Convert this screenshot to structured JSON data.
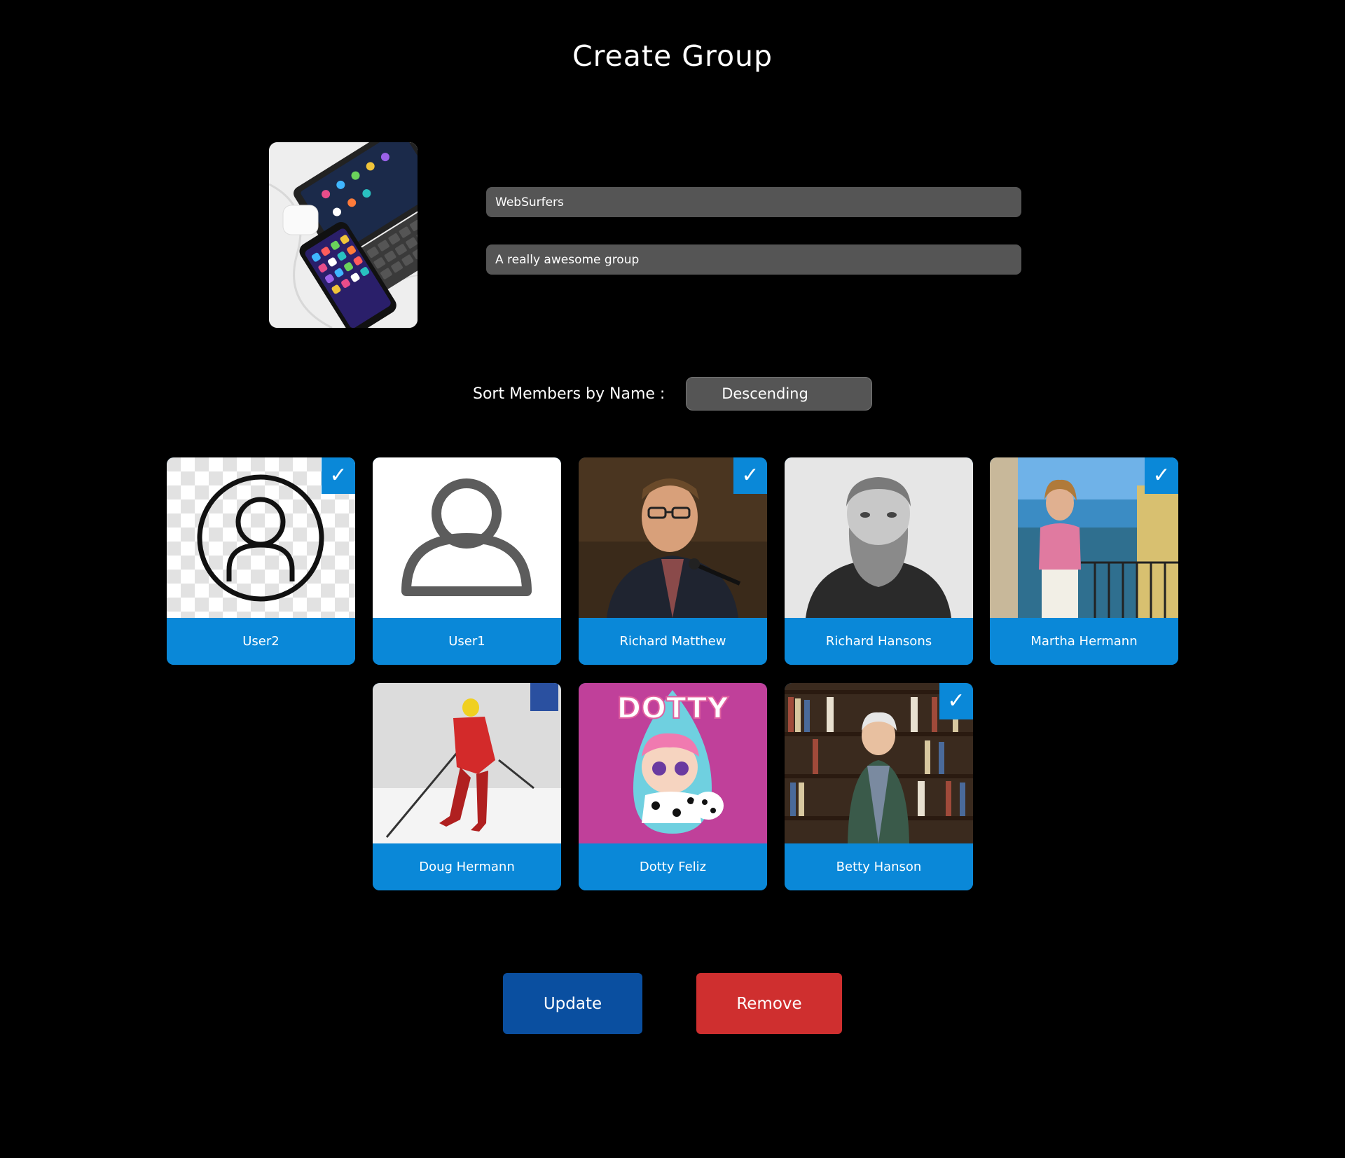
{
  "page": {
    "title": "Create Group"
  },
  "group": {
    "image_icon": "group-photo-devices",
    "name_value": "WebSurfers",
    "description_value": "A really awesome group"
  },
  "sort": {
    "label": "Sort Members by Name :",
    "selected": "Descending"
  },
  "members": [
    {
      "name": "User2",
      "selected": true,
      "photo": "default-avatar-outline-icon"
    },
    {
      "name": "User1",
      "selected": false,
      "photo": "default-avatar-gray-icon"
    },
    {
      "name": "Richard Matthew",
      "selected": true,
      "photo": "man-with-glasses-portrait"
    },
    {
      "name": "Richard Hansons",
      "selected": false,
      "photo": "bearded-man-vintage-portrait"
    },
    {
      "name": "Martha Hermann",
      "selected": true,
      "photo": "woman-on-balcony-portrait"
    },
    {
      "name": "Doug Hermann",
      "selected": false,
      "photo": "skier-photo"
    },
    {
      "name": "Dotty Feliz",
      "selected": false,
      "photo": "dotty-doll-illustration"
    },
    {
      "name": "Betty Hanson",
      "selected": true,
      "photo": "woman-in-library-portrait"
    }
  ],
  "badge": {
    "check_glyph": "✓"
  },
  "dotty_logo_text": "DOTTY",
  "actions": {
    "update_label": "Update",
    "remove_label": "Remove"
  },
  "colors": {
    "background": "#000000",
    "card_blue": "#0a88d8",
    "update_blue": "#0a4fa0",
    "remove_red": "#cf2f2f",
    "field_gray": "#555555"
  }
}
